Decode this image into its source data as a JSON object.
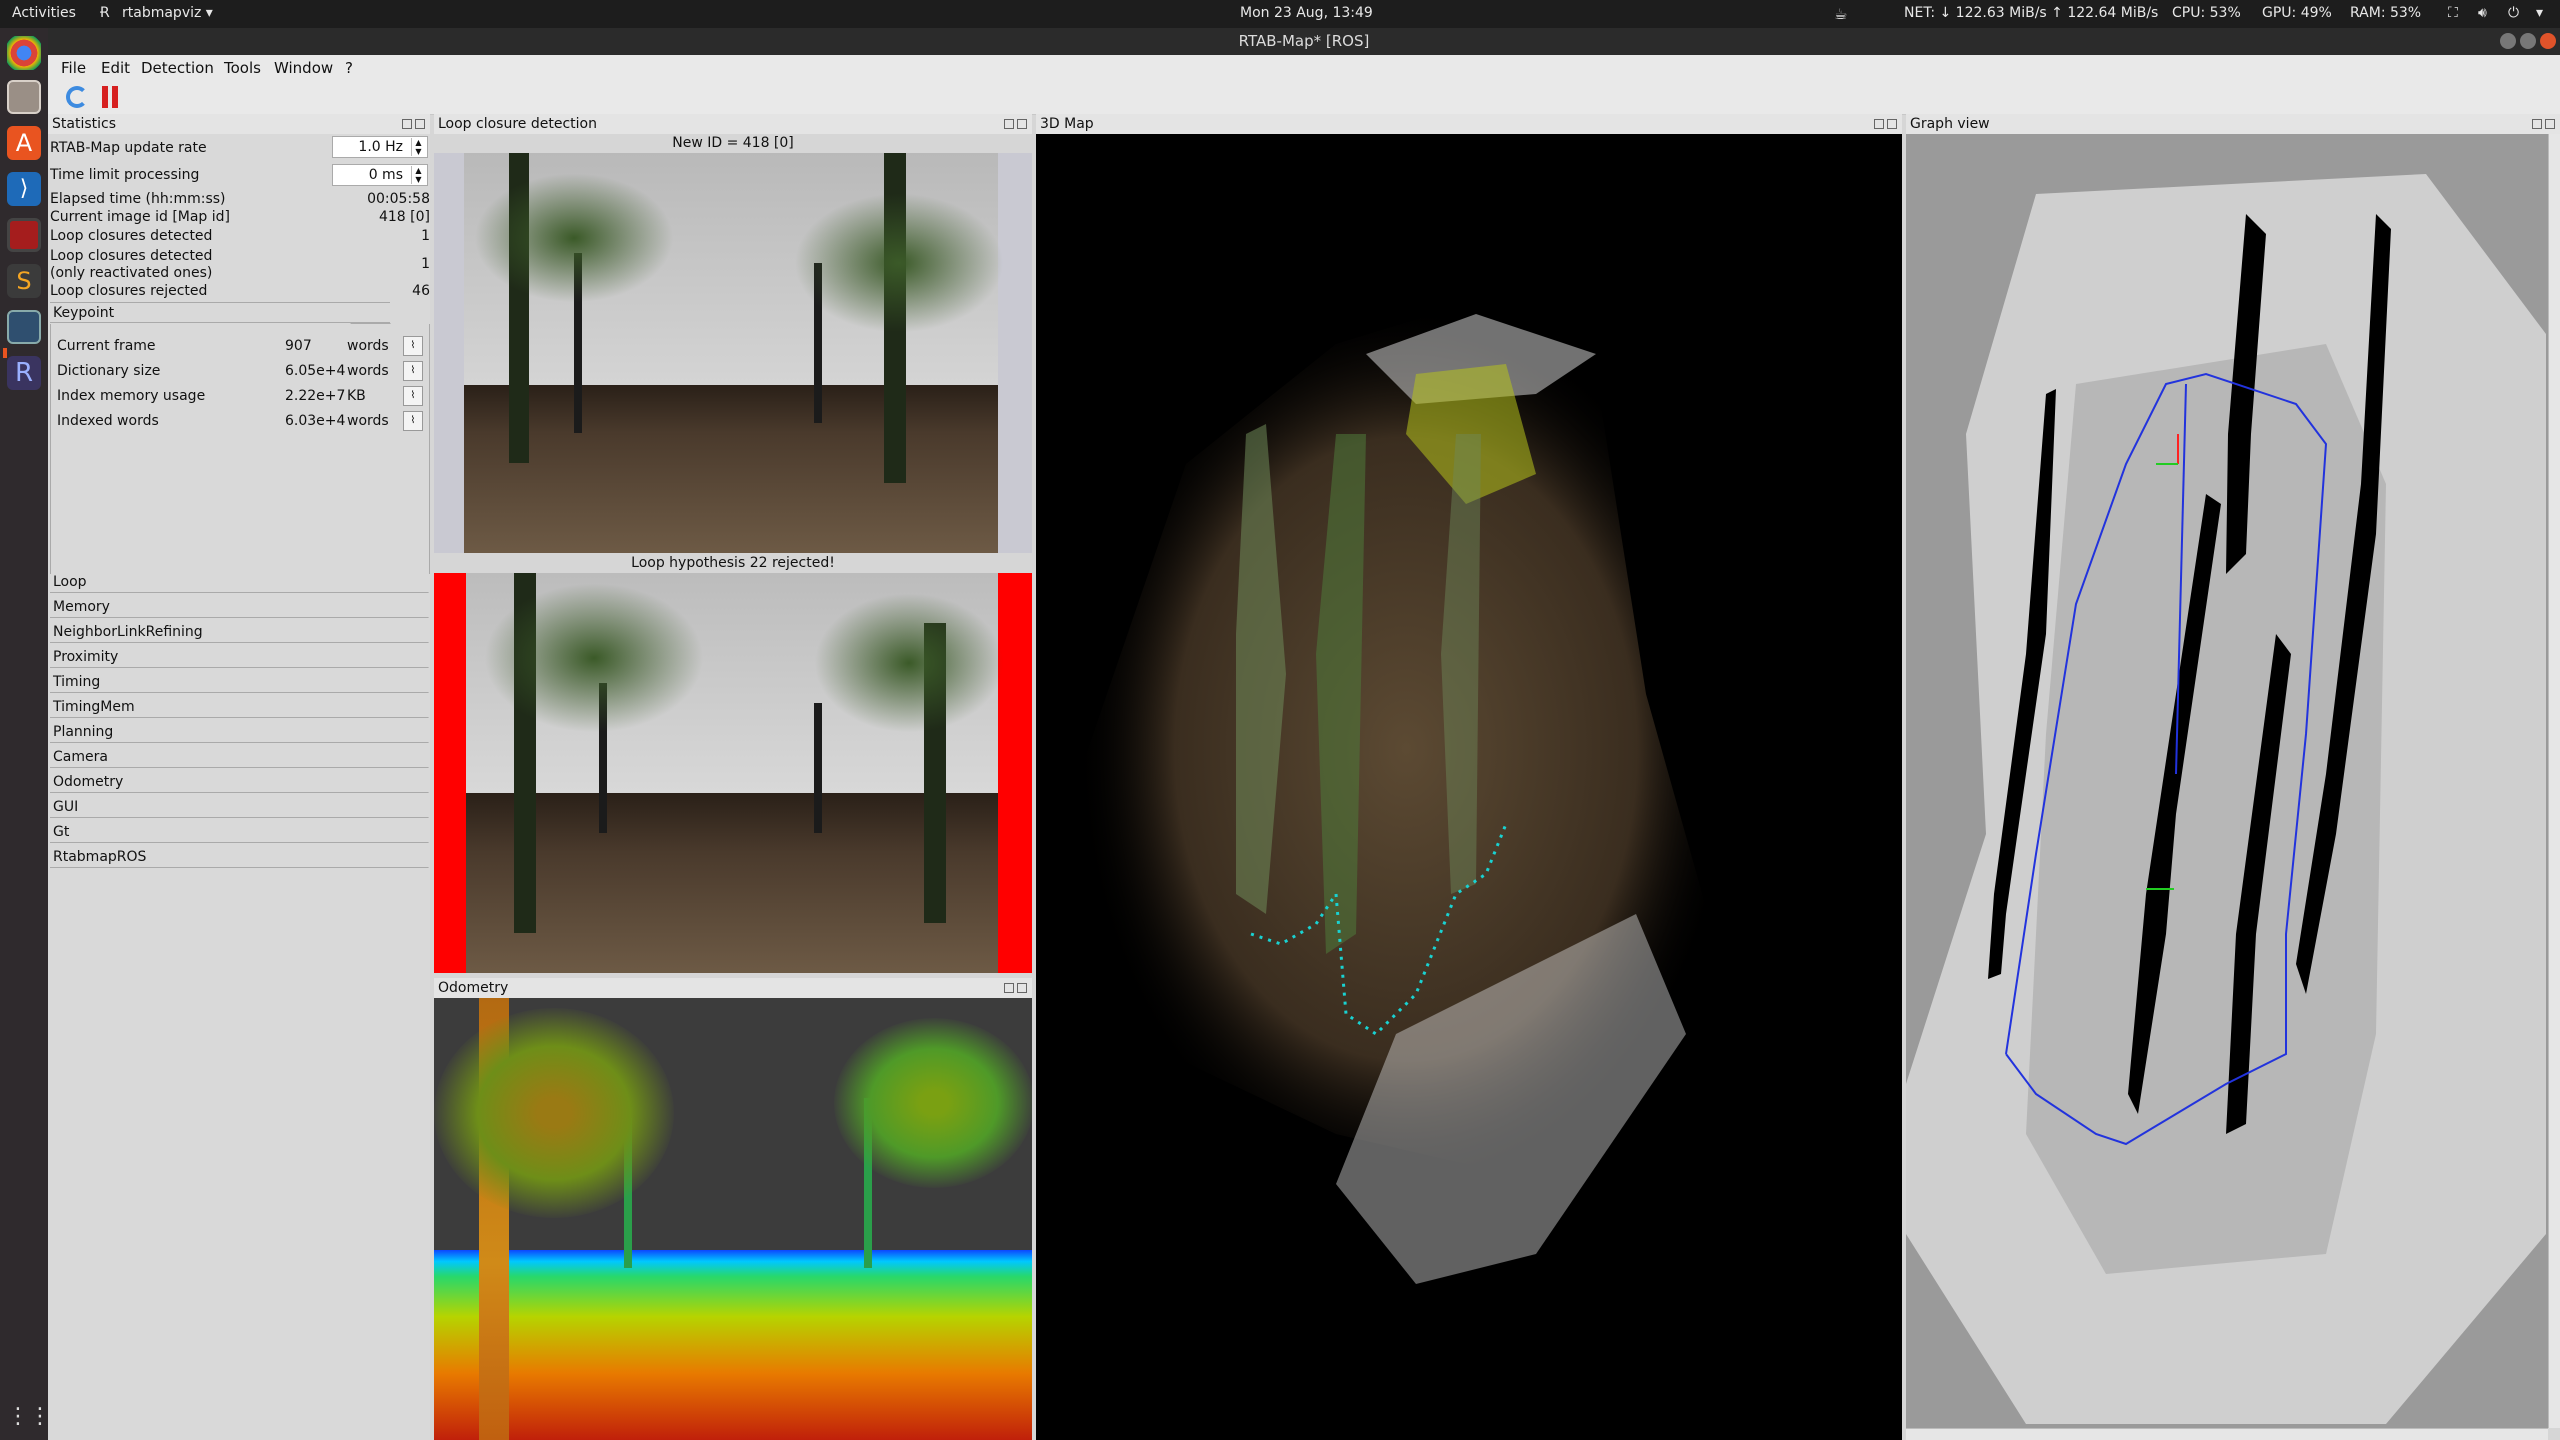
{
  "topbar": {
    "activities": "Activities",
    "app_menu": "rtabmapviz ▾",
    "clock": "Mon 23 Aug, 13:49",
    "net": "NET: ↓ 122.63 MiB/s ↑ 122.64 MiB/s",
    "cpu": "CPU: 53%",
    "gpu": "GPU: 49%",
    "ram": "RAM: 53%"
  },
  "window": {
    "title": "RTAB-Map* [ROS]"
  },
  "menubar": [
    "File",
    "Edit",
    "Detection",
    "Tools",
    "Window",
    "?"
  ],
  "docks": {
    "statistics": "Statistics",
    "loop": "Loop closure detection",
    "map3d": "3D Map",
    "graph": "Graph view",
    "odometry": "Odometry"
  },
  "stats": {
    "update_rate_label": "RTAB-Map update rate",
    "update_rate_value": "1.0 Hz",
    "time_limit_label": "Time limit processing",
    "time_limit_value": "0 ms",
    "rows": [
      {
        "label": "Elapsed time (hh:mm:ss)",
        "value": "00:05:58"
      },
      {
        "label": "Current image id [Map id]",
        "value": "418 [0]"
      },
      {
        "label": "Loop closures detected",
        "value": "1"
      },
      {
        "label": "Loop closures detected",
        "value": "1"
      },
      {
        "label": "(only reactivated ones)",
        "value": ""
      },
      {
        "label": "Loop closures rejected",
        "value": "46"
      }
    ],
    "keypoint_group": "Keypoint",
    "keypoint_rows": [
      {
        "name": "Current frame",
        "value": "907",
        "unit": "words"
      },
      {
        "name": "Dictionary size",
        "value": "6.05e+4",
        "unit": "words"
      },
      {
        "name": "Index memory usage",
        "value": "2.22e+7",
        "unit": "KB"
      },
      {
        "name": "Indexed words",
        "value": "6.03e+4",
        "unit": "words"
      }
    ],
    "groups": [
      "Loop",
      "Memory",
      "NeighborLinkRefining",
      "Proximity",
      "Timing",
      "TimingMem",
      "Planning",
      "Camera",
      "Odometry",
      "GUI",
      "Gt",
      "RtabmapROS"
    ]
  },
  "loop_closure": {
    "new_id": "New ID = 418 [0]",
    "hypothesis": "Loop hypothesis 22 rejected!"
  },
  "colors": {
    "reject_red": "#ff0000",
    "graph_path": "#2233dd",
    "map_bg": "#000000"
  }
}
